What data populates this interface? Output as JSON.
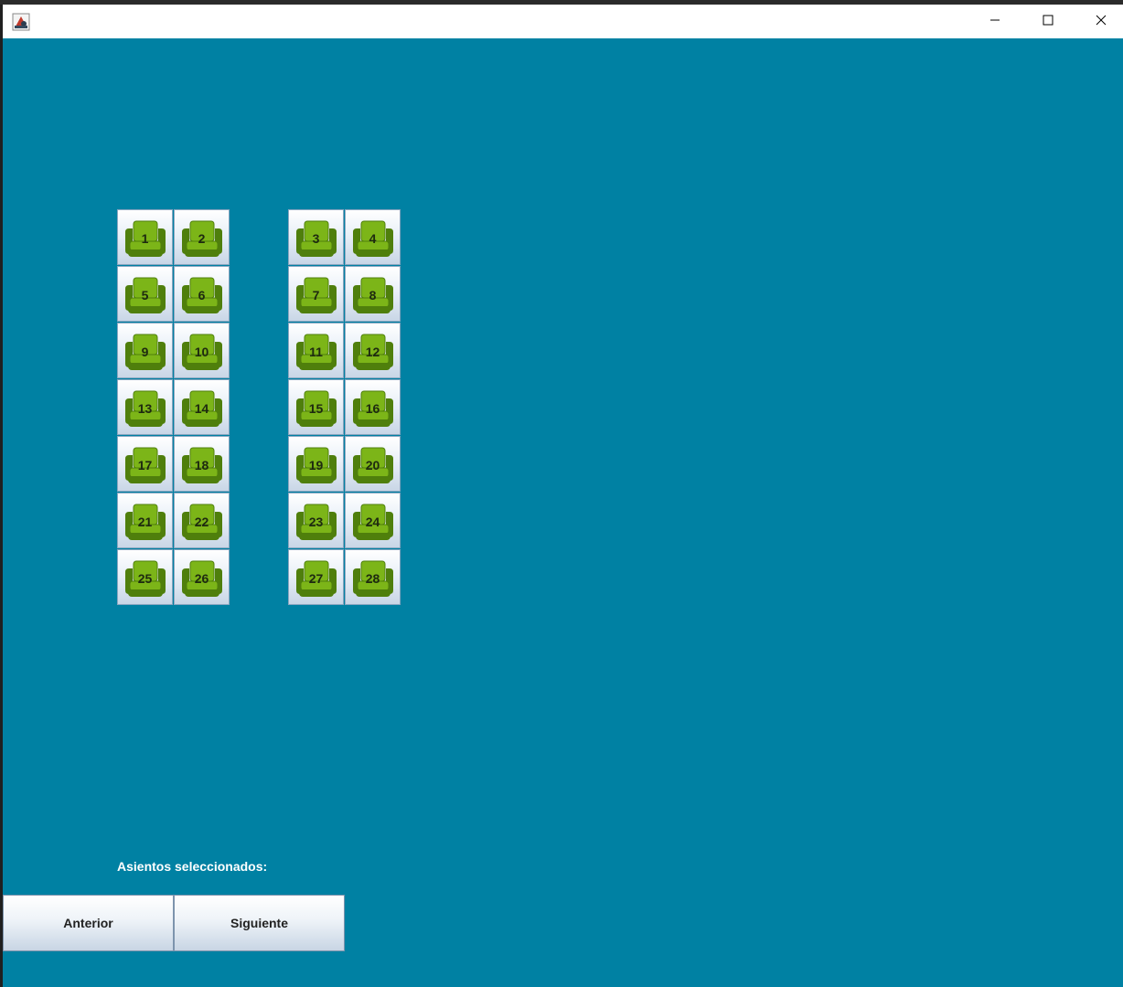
{
  "window": {
    "minimize_icon": "minimize-icon",
    "maximize_icon": "maximize-icon",
    "close_icon": "close-icon",
    "app_icon": "java-app-icon"
  },
  "seats": {
    "icon": "armchair-icon",
    "seat_color": "#7cb518",
    "seat_dark": "#4f7f0c",
    "left_block": [
      [
        "1",
        "2"
      ],
      [
        "5",
        "6"
      ],
      [
        "9",
        "10"
      ],
      [
        "13",
        "14"
      ],
      [
        "17",
        "18"
      ],
      [
        "21",
        "22"
      ],
      [
        "25",
        "26"
      ]
    ],
    "right_block": [
      [
        "3",
        "4"
      ],
      [
        "7",
        "8"
      ],
      [
        "11",
        "12"
      ],
      [
        "15",
        "16"
      ],
      [
        "19",
        "20"
      ],
      [
        "23",
        "24"
      ],
      [
        "27",
        "28"
      ]
    ]
  },
  "selection": {
    "label": "Asientos seleccionados:"
  },
  "navigation": {
    "prev_label": "Anterior",
    "next_label": "Siguiente"
  },
  "colors": {
    "background": "#0081a3",
    "titlebar": "#ffffff"
  }
}
